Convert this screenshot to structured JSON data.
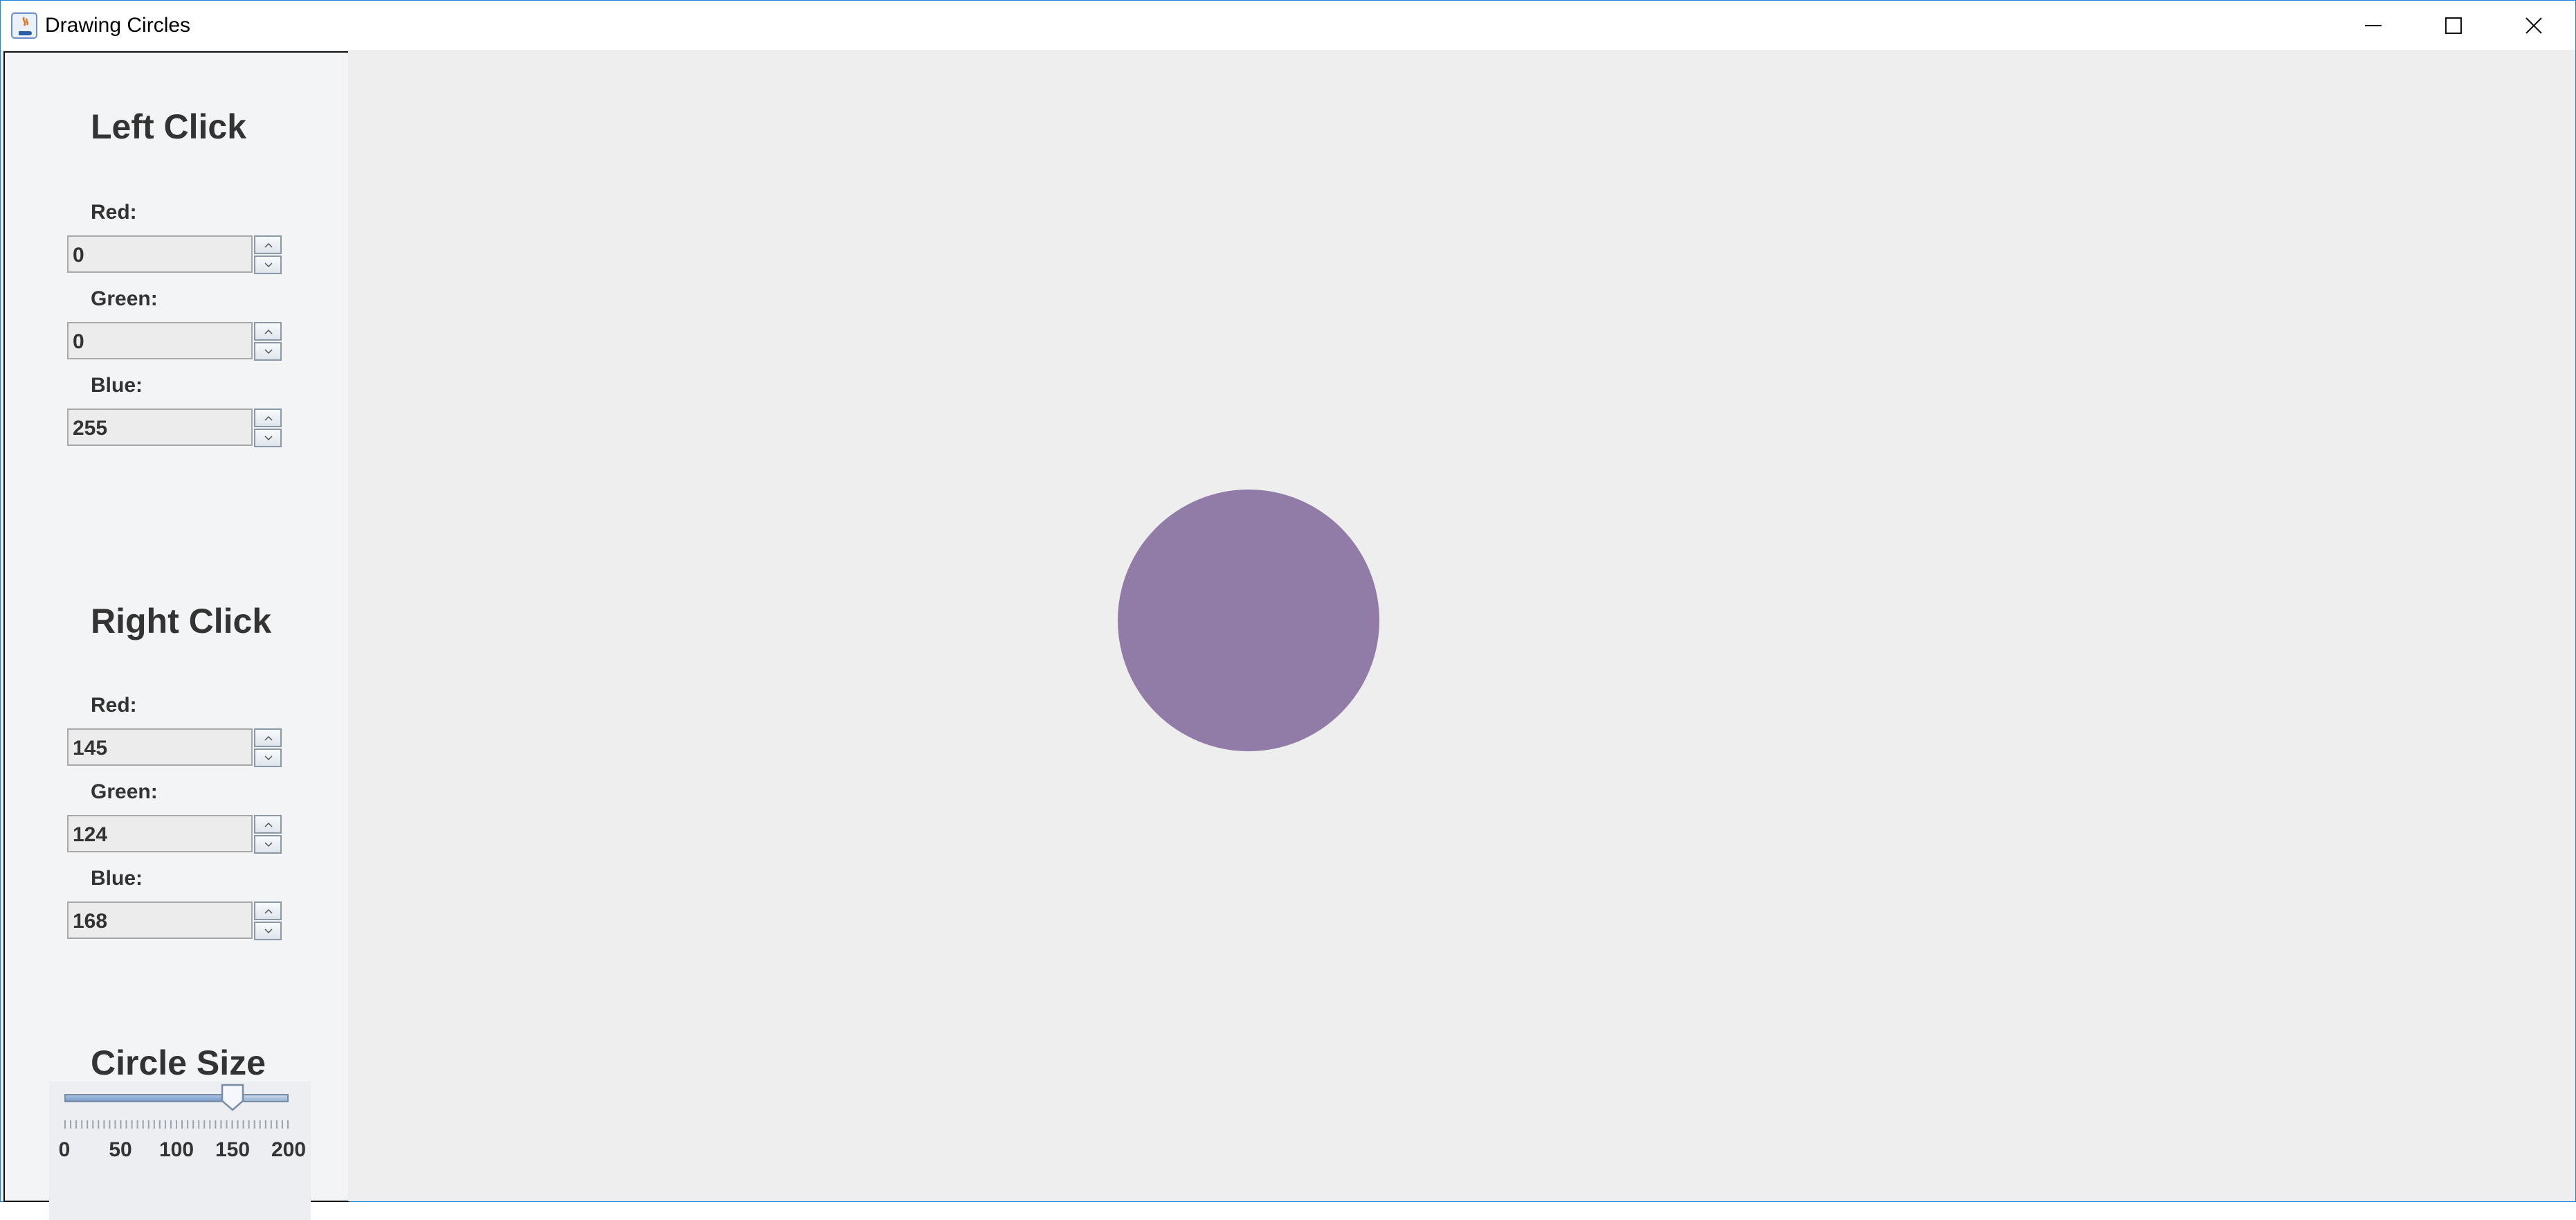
{
  "window": {
    "title": "Drawing Circles",
    "controls": [
      "minimize-icon",
      "maximize-icon",
      "close-icon"
    ]
  },
  "left_click": {
    "heading": "Left Click",
    "red_label": "Red:",
    "red_value": "0",
    "green_label": "Green:",
    "green_value": "0",
    "blue_label": "Blue:",
    "blue_value": "255"
  },
  "right_click": {
    "heading": "Right Click",
    "red_label": "Red:",
    "red_value": "145",
    "green_label": "Green:",
    "green_value": "124",
    "blue_label": "Blue:",
    "blue_value": "168"
  },
  "circle_size": {
    "heading": "Circle Size",
    "min": 0,
    "max": 200,
    "value": 150,
    "tick_labels": [
      "0",
      "50",
      "100",
      "150",
      "200"
    ]
  },
  "canvas": {
    "circle_color": "#917ca8"
  }
}
